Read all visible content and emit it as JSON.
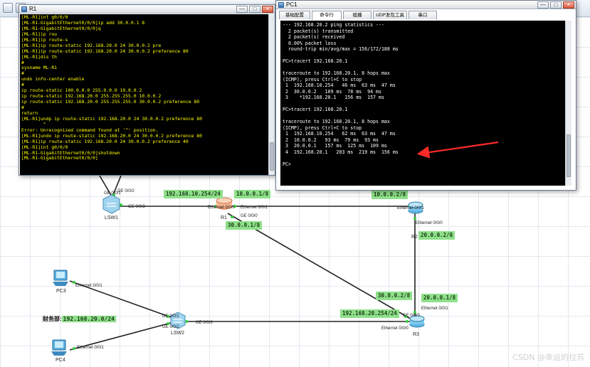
{
  "r1_window": {
    "title": "R1",
    "terminal_lines": [
      "[ML-R1]int g0/0/0",
      "[ML-R1-GigabitEthernet0/0/0]ip add 30.0.0.1 8",
      "[ML-R1-GigabitEthernet0/0/0]q",
      "[ML-R1]ip rou",
      "[ML-R1]ip route-s",
      "[ML-R1]ip route-static 192.168.20.0 24 30.0.0.2 pre",
      "[ML-R1]ip route-static 192.168.20.0 24 30.0.0.2 preference 80",
      "[ML-R1]dis th",
      "#",
      "sysname ML-R1",
      "#",
      "undo info-center enable",
      "#",
      "ip route-static 100.0.0.0 255.0.0.0 10.0.0.2",
      "ip route-static 192.168.20.0 255.255.255.0 10.0.0.2",
      "ip route-static 192.168.20.0 255.255.255.0 30.0.0.2 preference 80",
      "#",
      "return",
      "[ML-R1]undp ip route-static 192.168.20.0 24 30.0.0.2 preference 80",
      "        ^",
      "Error: Unrecognized command found at '^' position.",
      "[ML-R1]undo ip route-static 192.168.20.0 24 30.0.0.2 preference 80",
      "[ML-R1]ip route-static 192.168.20.0 24 30.0.0.2 preference 40",
      "[ML-R1]int g0/0/0",
      "[ML-R1-GigabitEthernet0/0/0]shutdown",
      "[ML-R1-GigabitEthernet0/0/0]"
    ]
  },
  "pc1_window": {
    "title": "PC1",
    "tabs": [
      "基础配置",
      "命令行",
      "组播",
      "UDP发包工具",
      "串口"
    ],
    "active_tab": "命令行",
    "terminal_lines": [
      "--- 192.168.20.2 ping statistics ---",
      "  2 packet(s) transmitted",
      "  2 packet(s) received",
      "  0.00% packet loss",
      "  round-trip min/avg/max = 156/172/188 ms",
      "",
      "PC>tracert 192.168.20.1",
      "",
      "traceroute to 192.168.20.1, 8 hops max",
      "(ICMP), press Ctrl+C to stop",
      " 1  192.168.10.254   46 ms  63 ms  47 ms",
      " 2  30.0.0.2   109 ms  78 ms  94 ms",
      " 3    *192.168.20.1   156 ms  157 ms",
      "",
      "PC>tracert 192.168.20.1",
      "",
      "traceroute to 192.168.20.1, 8 hops max",
      "(ICMP), press Ctrl+C to stop",
      " 1  192.168.10.254   62 ms  63 ms  47 ms",
      " 2  10.0.0.2   93 ms  79 ms  93 ms",
      " 3  20.0.0.1   157 ms  125 ms  109 ms",
      " 4  192.168.20.1   203 ms  219 ms  156 ms",
      "",
      "PC>"
    ]
  },
  "window_buttons": {
    "minimize": "—",
    "maximize": "□",
    "close": "×"
  },
  "topology": {
    "network_labels": {
      "net_192_168_10": "192.168.10.254/24",
      "net_10_0_0_1": "10.0.0.1/8",
      "net_10_0_0_2": "10.0.0.2/8",
      "net_30_0_0_1": "30.0.0.1/8",
      "net_20_0_0_2": "20.0.0.2/8",
      "net_30_0_0_2": "30.0.0.2/8",
      "net_20_0_0_1": "20.0.0.1/8",
      "net_192_168_20": "192.168.20.254/24"
    },
    "port_labels": {
      "lsw1_ge001": "GE 0/0/1",
      "lsw1_ge002": "GE 0/0/2",
      "lsw1_ge003": "GE 0/0/3",
      "r1_eth000": "Ethernet 0/0/0",
      "r1_eth001": "Ethernet 0/0/1",
      "r1_ge000": "GE 0/0/0",
      "r2_eth001": "Ethernet 0/0/1",
      "r2_eth000": "Ethernet 0/0/0",
      "r3_eth001": "Ethernet 0/0/1",
      "r3_ge000": "GE 0/0/0",
      "r3_eth000": "Ethernet 0/0/0",
      "pc3_eth001": "Ethernet 0/0/1",
      "pc4_eth001": "Ethernet 0/0/1",
      "lsw2_ge001": "GE 0/0/1",
      "lsw2_ge002": "GE 0/0/2",
      "lsw2_ge003": "GE 0/0/3"
    },
    "devices": {
      "lsw1": "LSW1",
      "r1": "R1",
      "r2": "R2",
      "r3": "R3",
      "pc3": "PC3",
      "pc4": "PC4",
      "lsw2": "LSW2"
    },
    "annotation_prefix": "财务部:",
    "annotation_net": "192.168.20.0/24"
  },
  "watermark": "CSDN @幸运的拉苏",
  "colors": {
    "terminal_r1_text": "#ffff00",
    "terminal_pc_text": "#ffffff",
    "net_label_bg": "#8ee08a",
    "arrow": "#ff2a2a"
  }
}
